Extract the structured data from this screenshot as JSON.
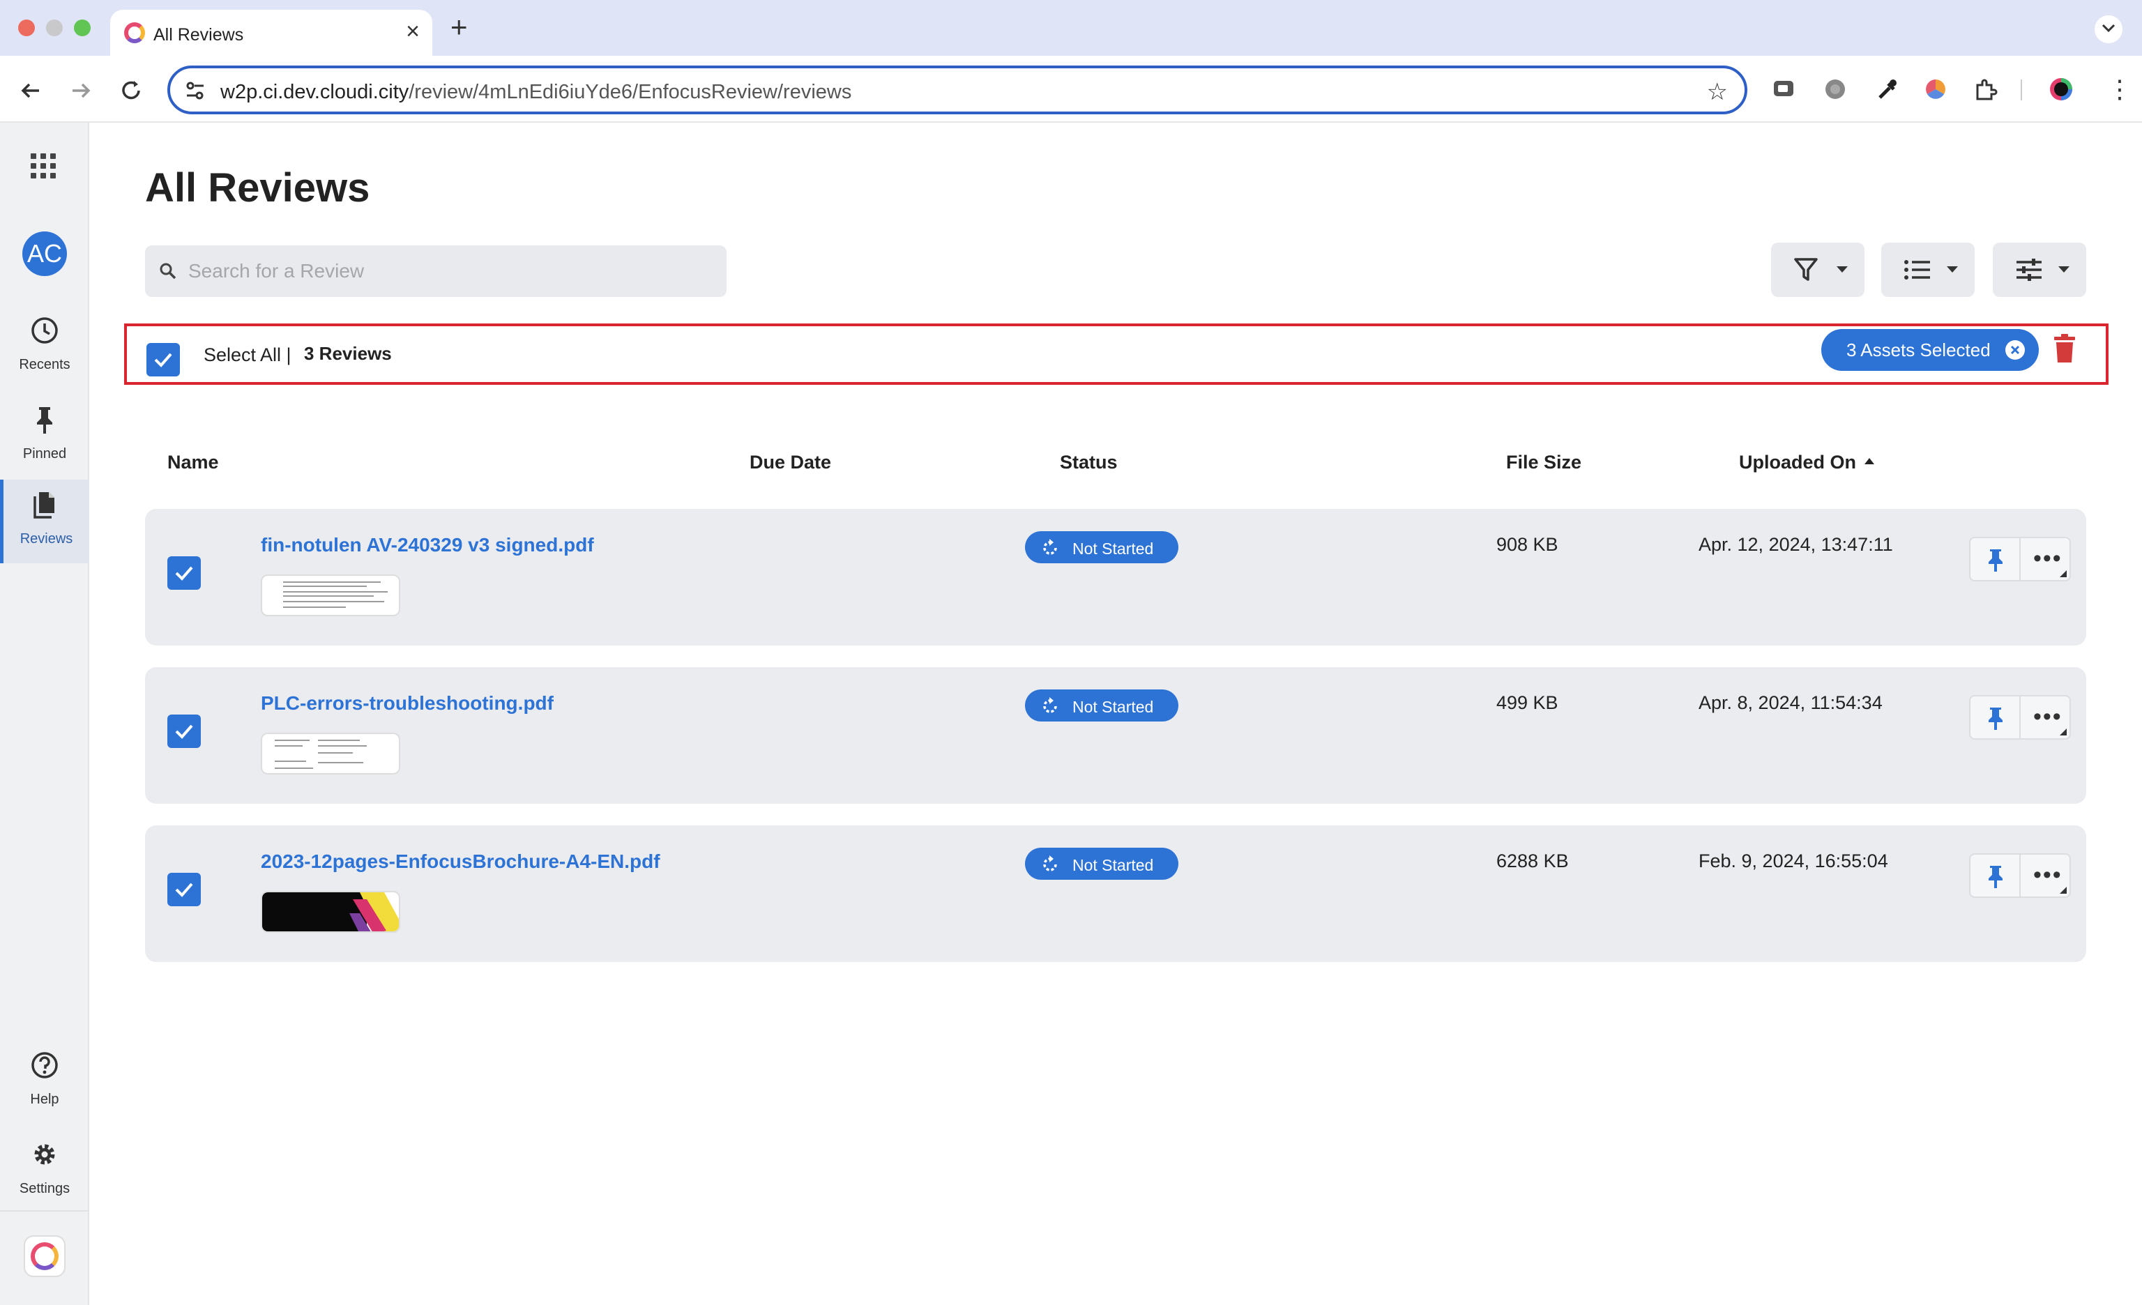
{
  "browser": {
    "tab_title": "All Reviews",
    "url_host": "w2p.ci.dev.cloudi.city",
    "url_path": "/review/4mLnEdi6iuYde6/EnfocusReview/reviews"
  },
  "sidebar": {
    "avatar_initials": "AC",
    "items": [
      {
        "label": "Recents",
        "icon": "clock-icon"
      },
      {
        "label": "Pinned",
        "icon": "pin-icon"
      },
      {
        "label": "Reviews",
        "icon": "documents-icon",
        "active": true
      },
      {
        "label": "Help",
        "icon": "help-icon"
      },
      {
        "label": "Settings",
        "icon": "gear-icon"
      }
    ]
  },
  "main": {
    "title": "All Reviews",
    "search": {
      "placeholder": "Search for a Review",
      "value": ""
    },
    "selection": {
      "select_all_label": "Select All |",
      "count_label": "3 Reviews",
      "chip_label": "3 Assets Selected"
    },
    "columns": {
      "name": "Name",
      "due_date": "Due Date",
      "status": "Status",
      "file_size": "File Size",
      "uploaded_on": "Uploaded On"
    },
    "rows": [
      {
        "name": "fin-notulen AV-240329 v3 signed.pdf",
        "status": "Not Started",
        "file_size": "908 KB",
        "uploaded_on": "Apr. 12, 2024, 13:47:11",
        "checked": true
      },
      {
        "name": "PLC-errors-troubleshooting.pdf",
        "status": "Not Started",
        "file_size": "499 KB",
        "uploaded_on": "Apr. 8, 2024, 11:54:34",
        "checked": true
      },
      {
        "name": "2023-12pages-EnfocusBrochure-A4-EN.pdf",
        "status": "Not Started",
        "file_size": "6288 KB",
        "uploaded_on": "Feb. 9, 2024, 16:55:04",
        "checked": true
      }
    ]
  },
  "colors": {
    "accent": "#2d73d6",
    "highlight_border": "#d9252e",
    "delete": "#d33a3a"
  }
}
